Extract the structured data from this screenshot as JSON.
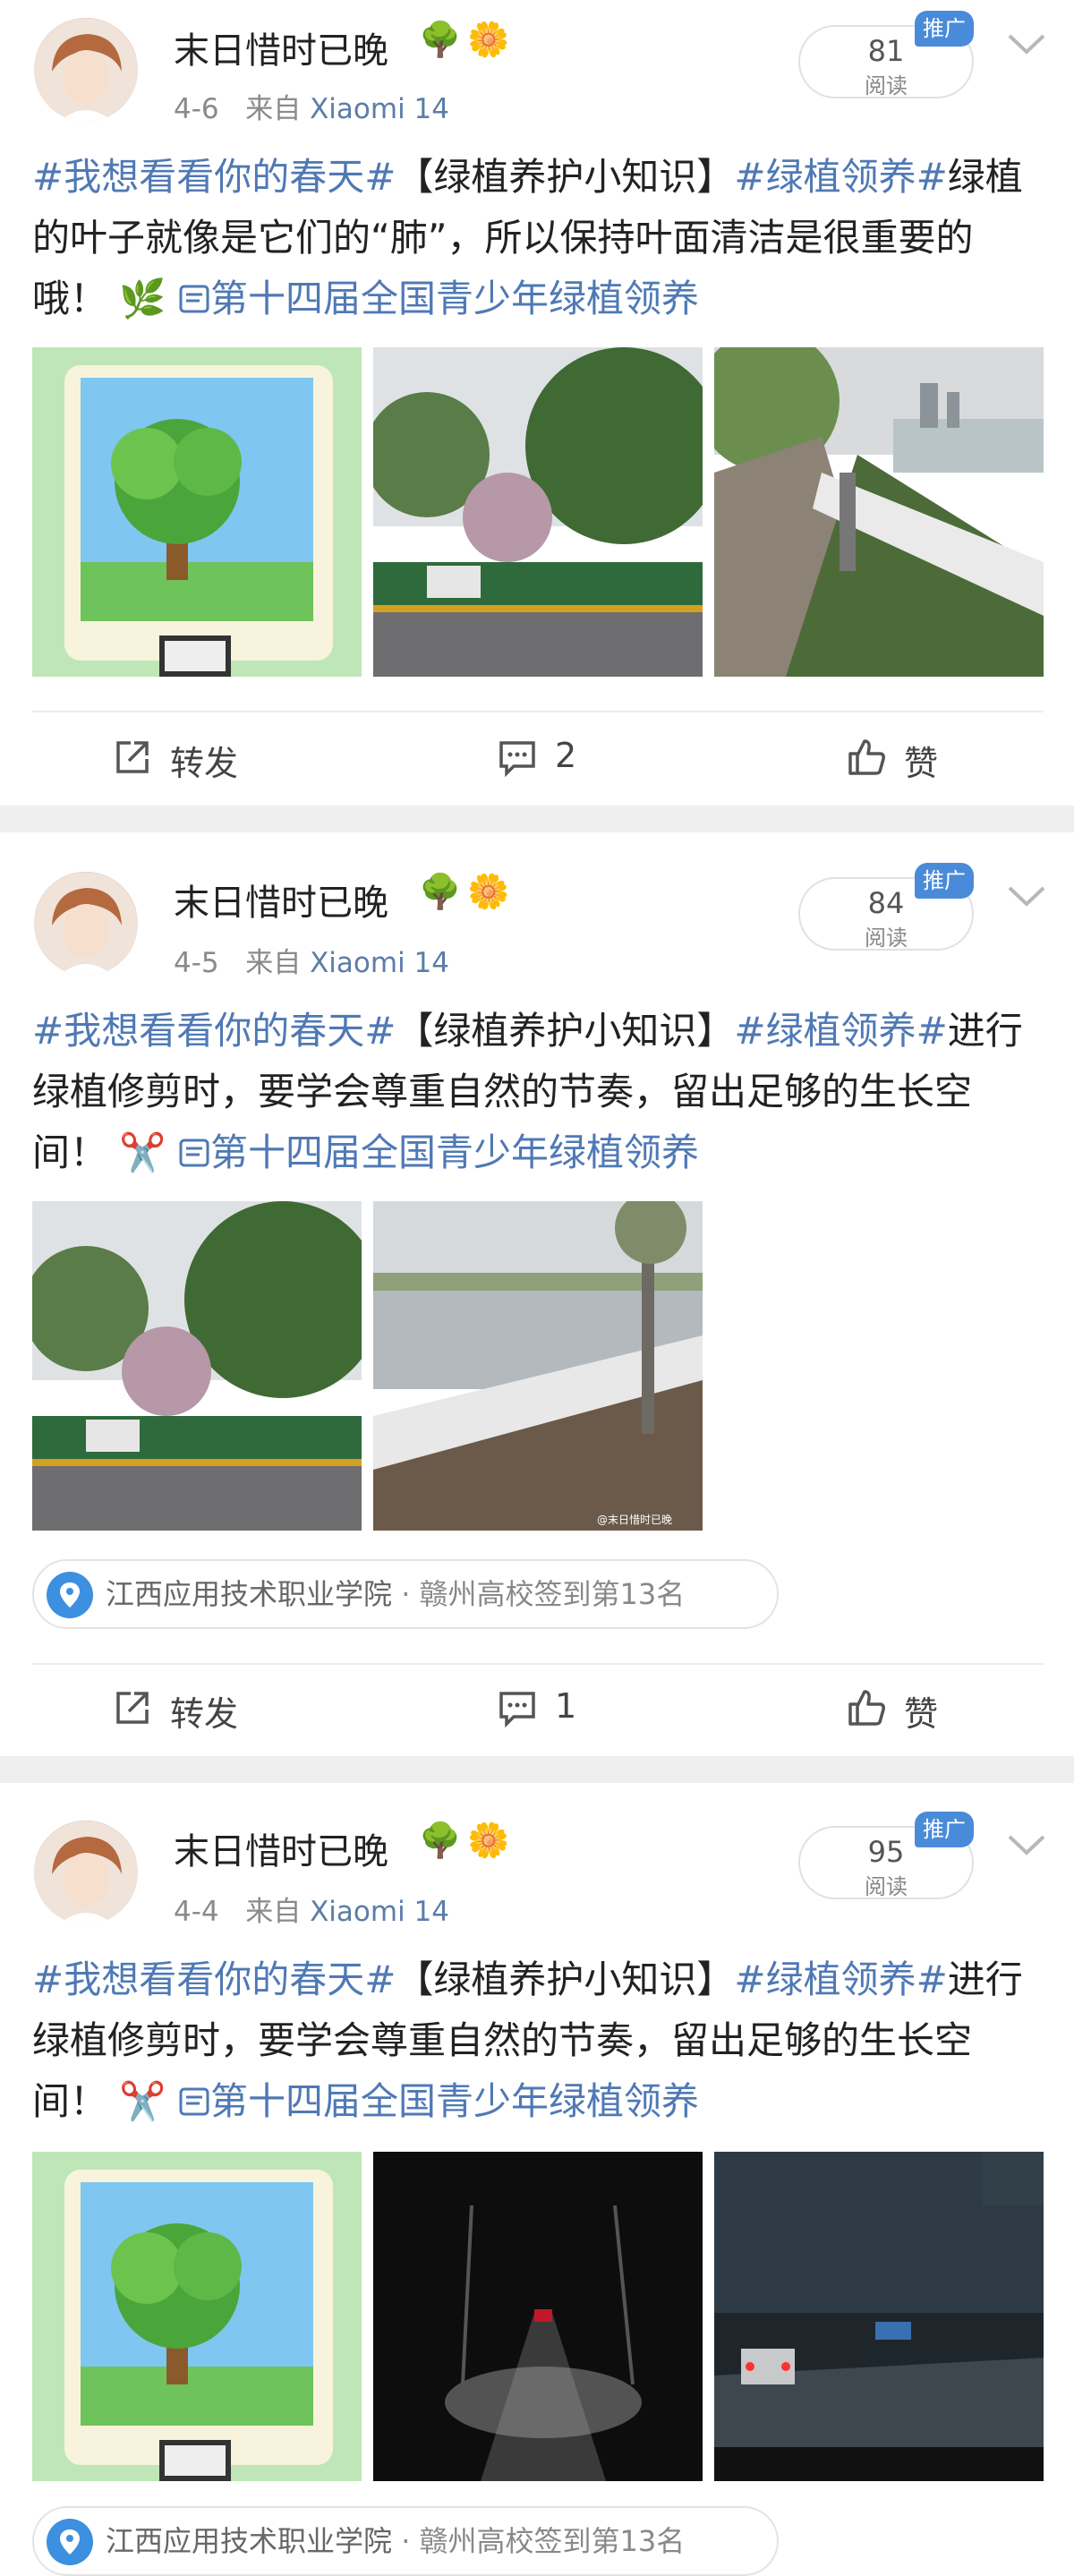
{
  "posts": [
    {
      "username": "末日惜时已晚",
      "emoji1": "🌳",
      "emoji2": "🌼",
      "date": "4-6",
      "from": "来自",
      "device": "Xiaomi 14",
      "reads": "81",
      "reads_label": "阅读",
      "promo": "推广",
      "tag1": "#我想看看你的春天#",
      "title": "【绿植养护小知识】",
      "tag2": "#绿植领养#",
      "body": "绿植的叶子就像是它们的“肺”，所以保持叶面清洁是很重要的哦！",
      "body_emoji": "🌿",
      "link": "第十四届全国青少年绿植领养",
      "forward": "转发",
      "comments": "2",
      "like": "赞"
    },
    {
      "username": "末日惜时已晚",
      "emoji1": "🌳",
      "emoji2": "🌼",
      "date": "4-5",
      "from": "来自",
      "device": "Xiaomi 14",
      "reads": "84",
      "reads_label": "阅读",
      "promo": "推广",
      "tag1": "#我想看看你的春天#",
      "title": "【绿植养护小知识】",
      "tag2": "#绿植领养#",
      "body": "进行绿植修剪时，要学会尊重自然的节奏，留出足够的生长空间！",
      "body_emoji": "✂️",
      "link": "第十四届全国青少年绿植领养",
      "location": "江西应用技术职业学院",
      "location_rank": "· 赣州高校签到第13名",
      "watermark": "@末日惜时已晚",
      "forward": "转发",
      "comments": "1",
      "like": "赞"
    },
    {
      "username": "末日惜时已晚",
      "emoji1": "🌳",
      "emoji2": "🌼",
      "date": "4-4",
      "from": "来自",
      "device": "Xiaomi 14",
      "reads": "95",
      "reads_label": "阅读",
      "promo": "推广",
      "tag1": "#我想看看你的春天#",
      "title": "【绿植养护小知识】",
      "tag2": "#绿植领养#",
      "body": "进行绿植修剪时，要学会尊重自然的节奏，留出足够的生长空间！",
      "body_emoji": "✂️",
      "link": "第十四届全国青少年绿植领养",
      "location": "江西应用技术职业学院",
      "location_rank": "· 赣州高校签到第13名"
    }
  ],
  "icons": {
    "link_icon": "link-icon",
    "forward_icon": "share-icon",
    "comment_icon": "comment-icon",
    "like_icon": "thumbs-up-icon",
    "location_icon": "location-pin-icon",
    "menu_icon": "chevron-down-icon"
  },
  "colors": {
    "tag_blue": "#4f79b5",
    "promo_blue": "#4a8bd9",
    "separator": "#efefef"
  }
}
